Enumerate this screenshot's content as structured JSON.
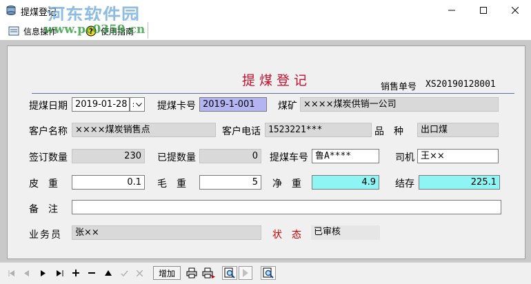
{
  "window": {
    "title": "提煤登记",
    "watermark": "河东软件园",
    "watermark_url": "www.pc0359.cn"
  },
  "menu": [
    {
      "label": "信息操作",
      "icon": "info-icon"
    },
    {
      "label": "使用指南",
      "icon": "help-icon"
    }
  ],
  "form": {
    "title": "提煤登记",
    "order_no_label": "销售单号",
    "order_no_value": "XS20190128001",
    "date_label": "提煤日期",
    "date_value": "2019-01-28",
    "date_sep": ":",
    "card_label": "提煤卡号",
    "card_value": "2019-1-001",
    "mine_label": "煤矿",
    "mine_value": "××××煤炭供销一公司",
    "customer_label": "客户名称",
    "customer_value": "××××煤炭销售点",
    "phone_label": "客户电话",
    "phone_value": "1523221***",
    "variety_label": "品　种",
    "variety_value": "出口煤",
    "signed_label": "签订数量",
    "signed_value": "230",
    "taken_label": "已提数量",
    "taken_value": "0",
    "vehicle_label": "提煤车号",
    "vehicle_value": "鲁A****",
    "driver_label": "司机",
    "driver_value": "王××",
    "tare_label": "皮　重",
    "tare_value": "0.1",
    "gross_label": "毛　重",
    "gross_value": "5",
    "net_label": "净　重",
    "net_value": "4.9",
    "balance_label": "结存",
    "balance_value": "225.1",
    "remark_label": "备　注",
    "remark_value": "",
    "clerk_label": "业务员",
    "clerk_value": "张××",
    "status_label": "状　态",
    "status_value": "已审核"
  },
  "toolbar": {
    "add_label": "增加"
  },
  "colors": {
    "title_red": "#c8102e",
    "net_cyan": "#8ef4f4",
    "card_lavender": "#b5b4f2"
  }
}
